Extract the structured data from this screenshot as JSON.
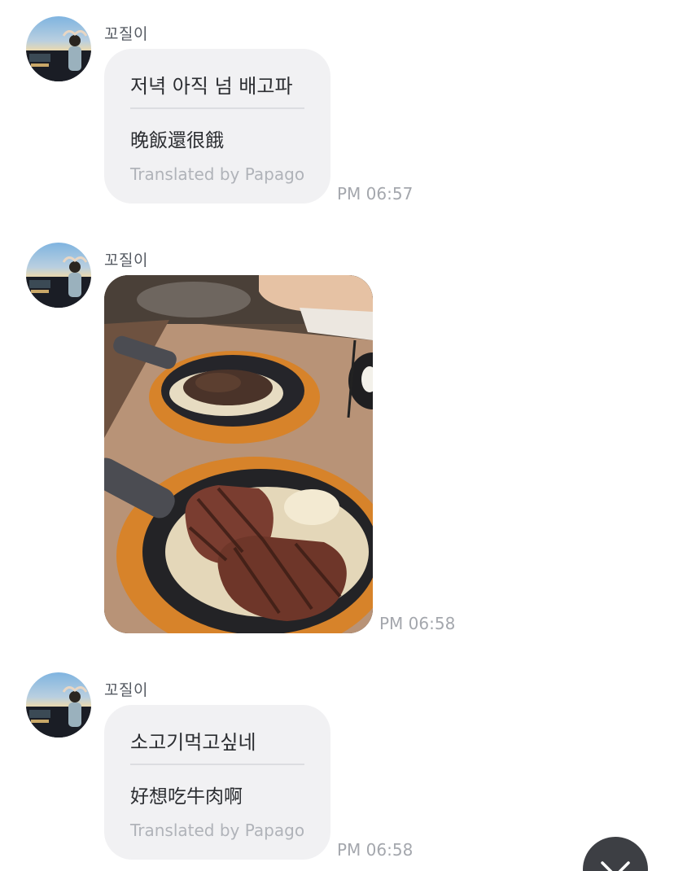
{
  "messages": [
    {
      "sender": "꼬질이",
      "original": "저녁 아직 넘 배고파",
      "translation": "晚飯還很餓",
      "translated_by": "Translated by Papago",
      "time": "PM 06:57"
    },
    {
      "sender": "꼬질이",
      "photo": "sizzling-steak-plates",
      "time": "PM 06:58"
    },
    {
      "sender": "꼬질이",
      "original": "소고기먹고싶네",
      "translation": "好想吃牛肉啊",
      "translated_by": "Translated by Papago",
      "time": "PM 06:58"
    }
  ],
  "scroll_button": {
    "icon": "chevron-down-icon"
  },
  "colors": {
    "bubble": "#f1f1f3",
    "text": "#2b2d31",
    "muted": "#b0b3b9",
    "scroll_button": "#3d3f44"
  }
}
